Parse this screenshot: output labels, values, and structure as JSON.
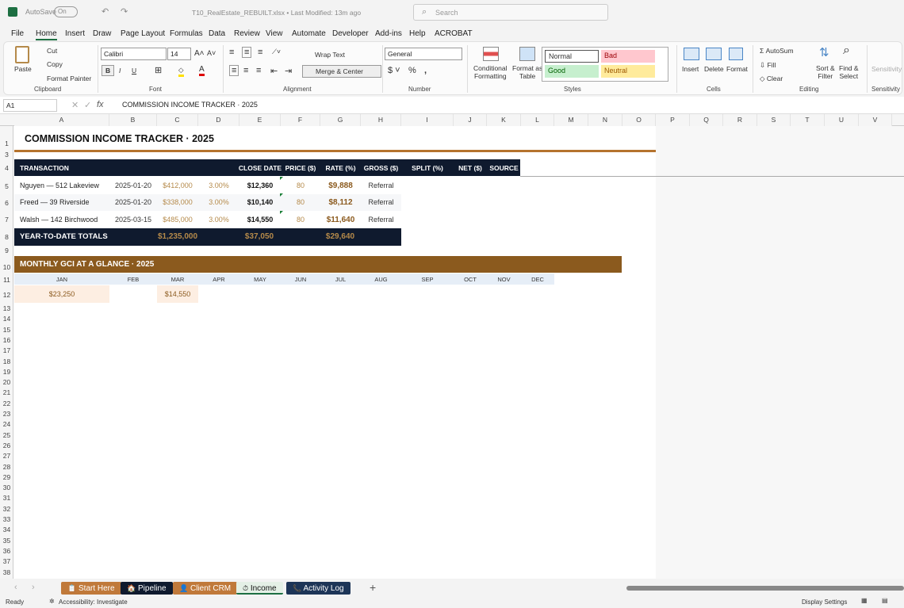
{
  "titlebar": {
    "autosave": "AutoSave",
    "toggle": "On",
    "filename": "T10_RealEstate_REBUILT.xlsx  •  Last Modified: 13m ago",
    "search_placeholder": "Search"
  },
  "menu": [
    "File",
    "Home",
    "Insert",
    "Draw",
    "Page Layout",
    "Formulas",
    "Data",
    "Review",
    "View",
    "Automate",
    "Developer",
    "Add-ins",
    "Help",
    "ACROBAT"
  ],
  "ribbon": {
    "paste": "Paste",
    "cut": "Cut",
    "copy": "Copy",
    "format_painter": "Format Painter",
    "clipboard": "Clipboard",
    "font_name": "Calibri",
    "font_size": "14",
    "font": "Font",
    "wrap_text": "Wrap Text",
    "merge_center": "Merge & Center",
    "alignment": "Alignment",
    "number_format": "General",
    "number": "Number",
    "conditional": "Conditional",
    "formatting": "Formatting",
    "format_as": "Format as",
    "table": "Table",
    "styles": {
      "normal": "Normal",
      "bad": "Bad",
      "good": "Good",
      "neutral": "Neutral",
      "label": "Styles"
    },
    "insert": "Insert",
    "delete": "Delete",
    "format": "Format",
    "cells": "Cells",
    "autosum": "AutoSum",
    "fill": "Fill",
    "clear": "Clear",
    "sort": "Sort &",
    "filter": "Filter",
    "find": "Find &",
    "select": "Select",
    "editing": "Editing",
    "sensitivity": "Sensitivity"
  },
  "formula_bar": {
    "name_box": "A1",
    "fx": "fx",
    "formula": "COMMISSION INCOME TRACKER  ·  2025"
  },
  "columns": [
    "A",
    "B",
    "C",
    "D",
    "E",
    "F",
    "G",
    "H",
    "I",
    "J",
    "K",
    "L",
    "M",
    "N",
    "O",
    "P",
    "Q",
    "R",
    "S",
    "T",
    "U",
    "V"
  ],
  "sheet": {
    "title": "COMMISSION INCOME TRACKER  ·  2025",
    "headers": [
      "TRANSACTION",
      "CLOSE DATE",
      "PRICE ($)",
      "RATE (%)",
      "GROSS ($)",
      "SPLIT (%)",
      "NET ($)",
      "SOURCE"
    ],
    "rows": [
      [
        "Nguyen — 512 Lakeview",
        "2025-01-20",
        "$412,000",
        "3.00%",
        "$12,360",
        "80",
        "$9,888",
        "Referral"
      ],
      [
        "Freed — 39 Riverside",
        "2025-01-20",
        "$338,000",
        "3.00%",
        "$10,140",
        "80",
        "$8,112",
        "Referral"
      ],
      [
        "Walsh — 142 Birchwood",
        "2025-03-15",
        "$485,000",
        "3.00%",
        "$14,550",
        "80",
        "$11,640",
        "Referral"
      ]
    ],
    "totals": {
      "label": "YEAR-TO-DATE TOTALS",
      "price": "$1,235,000",
      "gross": "$37,050",
      "net": "$29,640"
    },
    "monthly_title": "MONTHLY GCI AT A GLANCE  ·  2025",
    "months": [
      "JAN",
      "FEB",
      "MAR",
      "APR",
      "MAY",
      "JUN",
      "JUL",
      "AUG",
      "SEP",
      "OCT",
      "NOV",
      "DEC"
    ],
    "month_values": [
      "$23,250",
      "",
      "$14,550",
      "",
      "",
      "",
      "",
      "",
      "",
      "",
      "",
      ""
    ]
  },
  "tabs": [
    {
      "label": "Start Here",
      "color": "#c0793a"
    },
    {
      "label": "Pipeline",
      "color": "#0f1a2e"
    },
    {
      "label": "Client CRM",
      "color": "#c0793a"
    },
    {
      "label": "Income",
      "color": "#e4f0e6",
      "active": true
    },
    {
      "label": "Activity Log",
      "color": "#1d3557"
    }
  ],
  "status": {
    "ready": "Ready",
    "accessibility": "Accessibility: Investigate",
    "display": "Display Settings"
  },
  "colors": {
    "navy": "#0f1a2e",
    "brown": "#8b5a1e",
    "gold": "#b58a4a",
    "peach": "#fdeee2",
    "lightblue": "#e6eef7"
  }
}
